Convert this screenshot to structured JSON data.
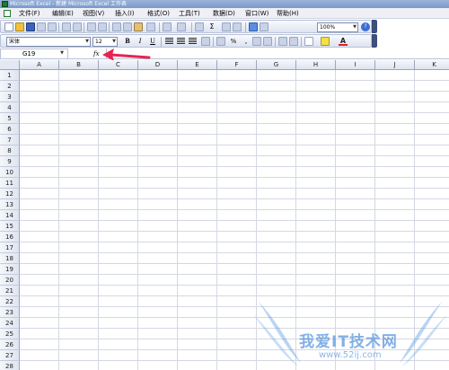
{
  "window": {
    "title": "Microsoft Excel - 新建 Microsoft Excel 工作表"
  },
  "menu": [
    {
      "id": "file",
      "label": "文件(F)"
    },
    {
      "id": "edit",
      "label": "编辑(E)"
    },
    {
      "id": "view",
      "label": "视图(V)"
    },
    {
      "id": "insert",
      "label": "插入(I)"
    },
    {
      "id": "format",
      "label": "格式(O)"
    },
    {
      "id": "tools",
      "label": "工具(T)"
    },
    {
      "id": "data",
      "label": "数据(D)"
    },
    {
      "id": "window",
      "label": "窗口(W)"
    },
    {
      "id": "help",
      "label": "帮助(H)"
    }
  ],
  "standard_toolbar": {
    "sum_symbol": "Σ",
    "zoom": "100%",
    "help_symbol": "?"
  },
  "formatting_toolbar": {
    "font": "宋体",
    "size": "12",
    "bold": "B",
    "italic": "I",
    "underline": "U",
    "percent": "%",
    "comma": ","
  },
  "formula_bar": {
    "name_box": "G19",
    "fx": "fx",
    "formula": ""
  },
  "annotation": {
    "arrow_color": "#e8234f"
  },
  "sheet": {
    "columns": [
      "A",
      "B",
      "C",
      "D",
      "E",
      "F",
      "G",
      "H",
      "I",
      "J",
      "K"
    ],
    "rows": [
      "1",
      "2",
      "3",
      "4",
      "5",
      "6",
      "7",
      "8",
      "9",
      "10",
      "11",
      "12",
      "13",
      "14",
      "15",
      "16",
      "17",
      "18",
      "19",
      "20",
      "21",
      "22",
      "23",
      "24",
      "25",
      "26",
      "27",
      "28"
    ]
  },
  "watermark": {
    "text": "我爱IT技术网",
    "url": "www.52ij.com"
  }
}
